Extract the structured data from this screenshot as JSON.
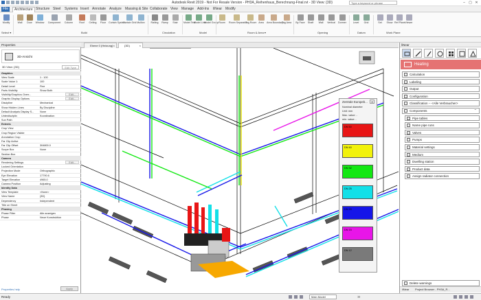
{
  "window": {
    "title": "Autodesk Revit 2019 - Not For Resale Version - PH3A_Reihenhaus_Berechnung-Final.rvt - 3D View: {3D}",
    "search_placeholder": "Type a keyword or phrase",
    "controls": [
      "–",
      "▢",
      "✕"
    ]
  },
  "menu": {
    "tabs": [
      "File",
      "Architecture",
      "Structure",
      "Steel",
      "Systems",
      "Insert",
      "Annotate",
      "Analyze",
      "Massing & Site",
      "Collaborate",
      "View",
      "Manage",
      "Add-Ins",
      "liNear",
      "Modify"
    ]
  },
  "ribbon": {
    "buttons": [
      "Modify",
      "Wall",
      "Door",
      "Window",
      "Component",
      "Column",
      "Roof",
      "Ceiling",
      "Floor",
      "Curtain System",
      "Curtain Grid",
      "Mullion",
      "Railing",
      "Ramp",
      "Stair",
      "Model Text",
      "Model Line",
      "Model Group",
      "Room",
      "Room Separator",
      "Tag Room",
      "Area",
      "Area Boundary",
      "Tag Area",
      "By Face",
      "Shaft",
      "Wall",
      "Vertical",
      "Dormer",
      "Level",
      "Grid",
      "Set",
      "Show",
      "Ref Plane",
      "Viewer"
    ],
    "groups": [
      "Select ▾",
      "Build",
      "Circulation",
      "Model",
      "Room & Area ▾",
      "Opening",
      "Datum",
      "Work Plane"
    ]
  },
  "properties": {
    "header": "Properties",
    "type_name": "3D-Ansicht",
    "view_selector": "3D View: {3D}",
    "edit_type": "Edit Type",
    "rows": [
      {
        "k": "Graphics",
        "v": "",
        "cat": true
      },
      {
        "k": "View Scale",
        "v": "1 : 100"
      },
      {
        "k": "Scale Value 1:",
        "v": "100"
      },
      {
        "k": "Detail Level",
        "v": "Fine"
      },
      {
        "k": "Parts Visibility",
        "v": "Show Both"
      },
      {
        "k": "Visibility/Graphics Overr...",
        "v": "",
        "btn": "Edit..."
      },
      {
        "k": "Graphic Display Options",
        "v": "",
        "btn": "Edit..."
      },
      {
        "k": "Discipline",
        "v": "Mechanical"
      },
      {
        "k": "Show Hidden Lines",
        "v": "By Discipline"
      },
      {
        "k": "Default Analysis Display S...",
        "v": "None"
      },
      {
        "k": "Unterdisziplin",
        "v": "Koordination"
      },
      {
        "k": "Sun Path",
        "v": ""
      },
      {
        "k": "Extents",
        "v": "",
        "cat": true
      },
      {
        "k": "Crop View",
        "v": ""
      },
      {
        "k": "Crop Region Visible",
        "v": ""
      },
      {
        "k": "Annotation Crop",
        "v": ""
      },
      {
        "k": "Far Clip Active",
        "v": ""
      },
      {
        "k": "Far Clip Offset",
        "v": "304800.0"
      },
      {
        "k": "Scope Box",
        "v": "None"
      },
      {
        "k": "Section Box",
        "v": ""
      },
      {
        "k": "Camera",
        "v": "",
        "cat": true
      },
      {
        "k": "Rendering Settings",
        "v": "",
        "btn": "Edit..."
      },
      {
        "k": "Locked Orientation",
        "v": ""
      },
      {
        "k": "Projection Mode",
        "v": "Orthographic"
      },
      {
        "k": "Eye Elevation",
        "v": "17790.6"
      },
      {
        "k": "Target Elevation",
        "v": "4965.0"
      },
      {
        "k": "Camera Position",
        "v": "Adjusting"
      },
      {
        "k": "Identity Data",
        "v": "",
        "cat": true
      },
      {
        "k": "View Template",
        "v": "<None>"
      },
      {
        "k": "View Name",
        "v": "{3D}"
      },
      {
        "k": "Dependency",
        "v": "Independent"
      },
      {
        "k": "Title on Sheet",
        "v": ""
      },
      {
        "k": "Phasing",
        "v": "",
        "cat": true
      },
      {
        "k": "Phase Filter",
        "v": "Alle anzeigen"
      },
      {
        "k": "Phase",
        "v": "Neue Konstruktion"
      }
    ],
    "help": "Properties help",
    "apply": "Apply"
  },
  "views": {
    "tabs": [
      "Ebene 0 (Heizung)",
      "{3D}"
    ]
  },
  "legend": {
    "title": "Zentrale Europeb...",
    "lines": [
      "Nominal diameter",
      "Unit: mm",
      "Max. value: -",
      "min. value: -"
    ],
    "swatches": [
      {
        "label": "DN 50",
        "color": "#e81515"
      },
      {
        "label": "DN 40",
        "color": "#f2f20a"
      },
      {
        "label": "DN 32",
        "color": "#12e812"
      },
      {
        "label": "DN 25",
        "color": "#12e0e8"
      },
      {
        "label": "DN 20",
        "color": "#1515e8"
      },
      {
        "label": "DN 15",
        "color": "#e815e8"
      },
      {
        "label": "DN 12",
        "color": "#7a7a7a"
      }
    ]
  },
  "panel": {
    "header": "liNear",
    "section": "Heating",
    "items": [
      {
        "label": "Calculation"
      },
      {
        "label": "Labeling"
      },
      {
        "label": "Output"
      },
      {
        "label": "Configuration"
      },
      {
        "label": "Classification -- <Alle Verbraucher>"
      },
      {
        "label": "Components",
        "expanded": true
      },
      {
        "label": "Pipe tables",
        "sub": true
      },
      {
        "label": "Name pipe runs",
        "sub": true
      },
      {
        "label": "Valves",
        "sub": true
      },
      {
        "label": "Pumps",
        "sub": true
      },
      {
        "label": "Material settings",
        "sub": true
      },
      {
        "label": "Medium",
        "sub": true
      },
      {
        "label": "Dwelling station",
        "sub": true
      },
      {
        "label": "Product data",
        "sub": true
      },
      {
        "label": "Assign radiator connection",
        "sub": true
      }
    ],
    "delete_warnings": "Delete warnings",
    "bottom_tabs": [
      "liNear",
      "Project Browser - PH3A_R..."
    ]
  },
  "status": {
    "text": "Ready",
    "model": "Main Model",
    "zoom": ":0"
  }
}
